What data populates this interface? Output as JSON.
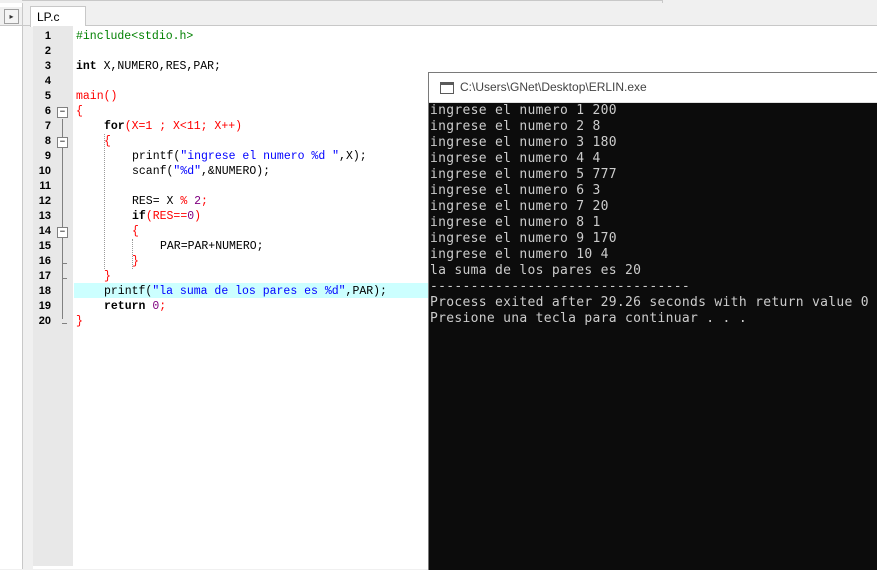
{
  "editor": {
    "tab_label": "LP.c",
    "line_numbers": [
      "1",
      "2",
      "3",
      "4",
      "5",
      "6",
      "7",
      "8",
      "9",
      "10",
      "11",
      "12",
      "13",
      "14",
      "15",
      "16",
      "17",
      "18",
      "19",
      "20"
    ]
  },
  "left_panel": {
    "arrow_icon": "triangle-right-icon"
  },
  "code": {
    "l1": "#include<stdio.h>",
    "l3_kw": "int",
    "l3_rest": " X,NUMERO,RES,PAR;",
    "l5": "main()",
    "l6": "{",
    "l7_kw": "for",
    "l7_rest": "(X=1 ; X<11; X++)",
    "l8": "{",
    "l9_fn": "printf(",
    "l9_str": "\"ingrese el numero %d \"",
    "l9_rest": ",X);",
    "l10_fn": "scanf(",
    "l10_str": "\"%d\"",
    "l10_rest": ",&NUMERO);",
    "l12_a": "RES= X ",
    "l12_b": "% ",
    "l12_c": "2",
    "l12_d": ";",
    "l13_kw": "if",
    "l13_rest": "(RES==",
    "l13_num": "0",
    "l13_end": ")",
    "l14": "{",
    "l15": "PAR=PAR+NUMERO;",
    "l16": "}",
    "l17": "}",
    "l18_fn": "printf(",
    "l18_str": "\"la suma de los pares es %d\"",
    "l18_rest": ",PAR);",
    "l19_kw": "return",
    "l19_num": " 0",
    "l19_end": ";",
    "l20": "}"
  },
  "console": {
    "title": "C:\\Users\\GNet\\Desktop\\ERLIN.exe",
    "lines": [
      "ingrese el numero 1 200",
      "ingrese el numero 2 8",
      "ingrese el numero 3 180",
      "ingrese el numero 4 4",
      "ingrese el numero 5 777",
      "ingrese el numero 6 3",
      "ingrese el numero 7 20",
      "ingrese el numero 8 1",
      "ingrese el numero 9 170",
      "ingrese el numero 10 4",
      "la suma de los pares es 20",
      "--------------------------------",
      "Process exited after 29.26 seconds with return value 0",
      "Presione una tecla para continuar . . ."
    ]
  }
}
